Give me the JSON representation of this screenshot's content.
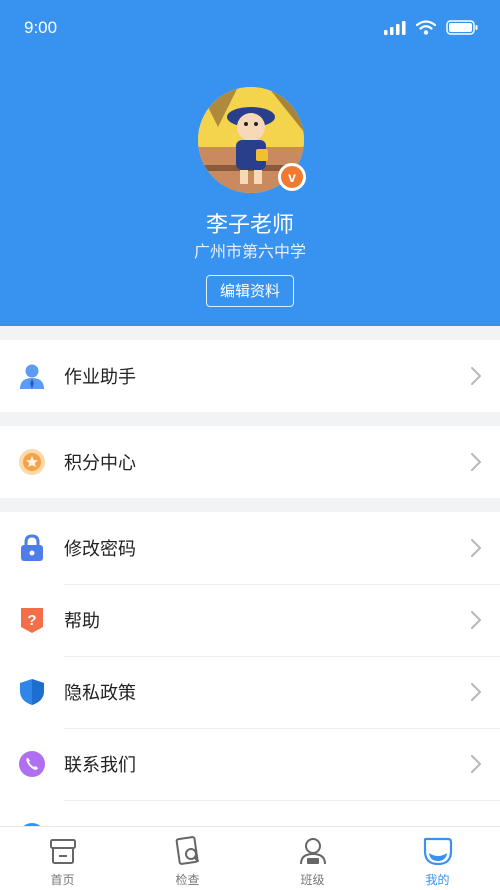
{
  "status_bar": {
    "time": "9:00"
  },
  "profile": {
    "name": "李子老师",
    "school": "广州市第六中学",
    "edit_label": "编辑资料",
    "badge": "v"
  },
  "menu": {
    "homework": "作业助手",
    "points": "积分中心",
    "password": "修改密码",
    "help": "帮助",
    "privacy": "隐私政策",
    "contact": "联系我们"
  },
  "tabs": [
    {
      "label": "首页"
    },
    {
      "label": "检查"
    },
    {
      "label": "班级"
    },
    {
      "label": "我的",
      "active": true
    }
  ],
  "colors": {
    "header": "#3893f0",
    "tab_active": "#3893f0"
  }
}
